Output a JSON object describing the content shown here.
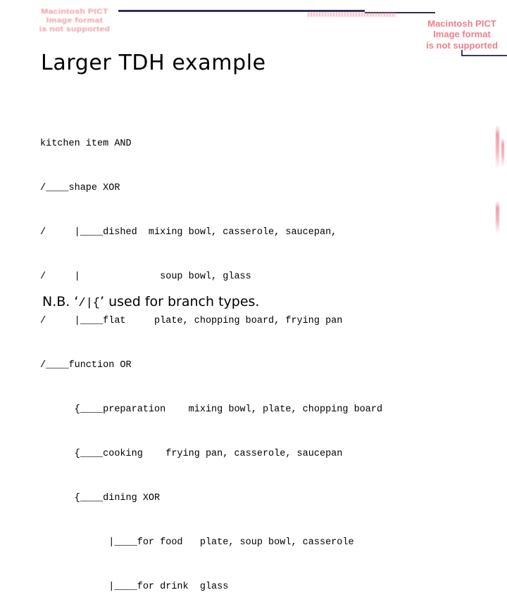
{
  "slide": {
    "title": "Larger TDH example",
    "note_prefix": "N.B. ‘",
    "note_branch_chars": "/|{",
    "note_suffix": "’ used for branch types."
  },
  "placeholders": {
    "left": "Macintosh PICT\nImage format\nis not supported",
    "right": "Macintosh PICT\nImage format\nis not supported"
  },
  "tree": {
    "lines": [
      "kitchen item AND",
      "/____shape XOR",
      "/     |____dished  mixing bowl, casserole, saucepan,",
      "/     |              soup bowl, glass",
      "/     |____flat     plate, chopping board, frying pan",
      "/____function OR",
      "      {____preparation    mixing bowl, plate, chopping board",
      "      {____cooking    frying pan, casserole, saucepan",
      "      {____dining XOR",
      "            |____for food   plate, soup bowl, casserole",
      "            |____for drink  glass"
    ]
  },
  "colors": {
    "placeholder_pink": "#ef7f8c",
    "rule_navy": "#2f3058",
    "text_black": "#000000",
    "background": "#ffffff"
  }
}
